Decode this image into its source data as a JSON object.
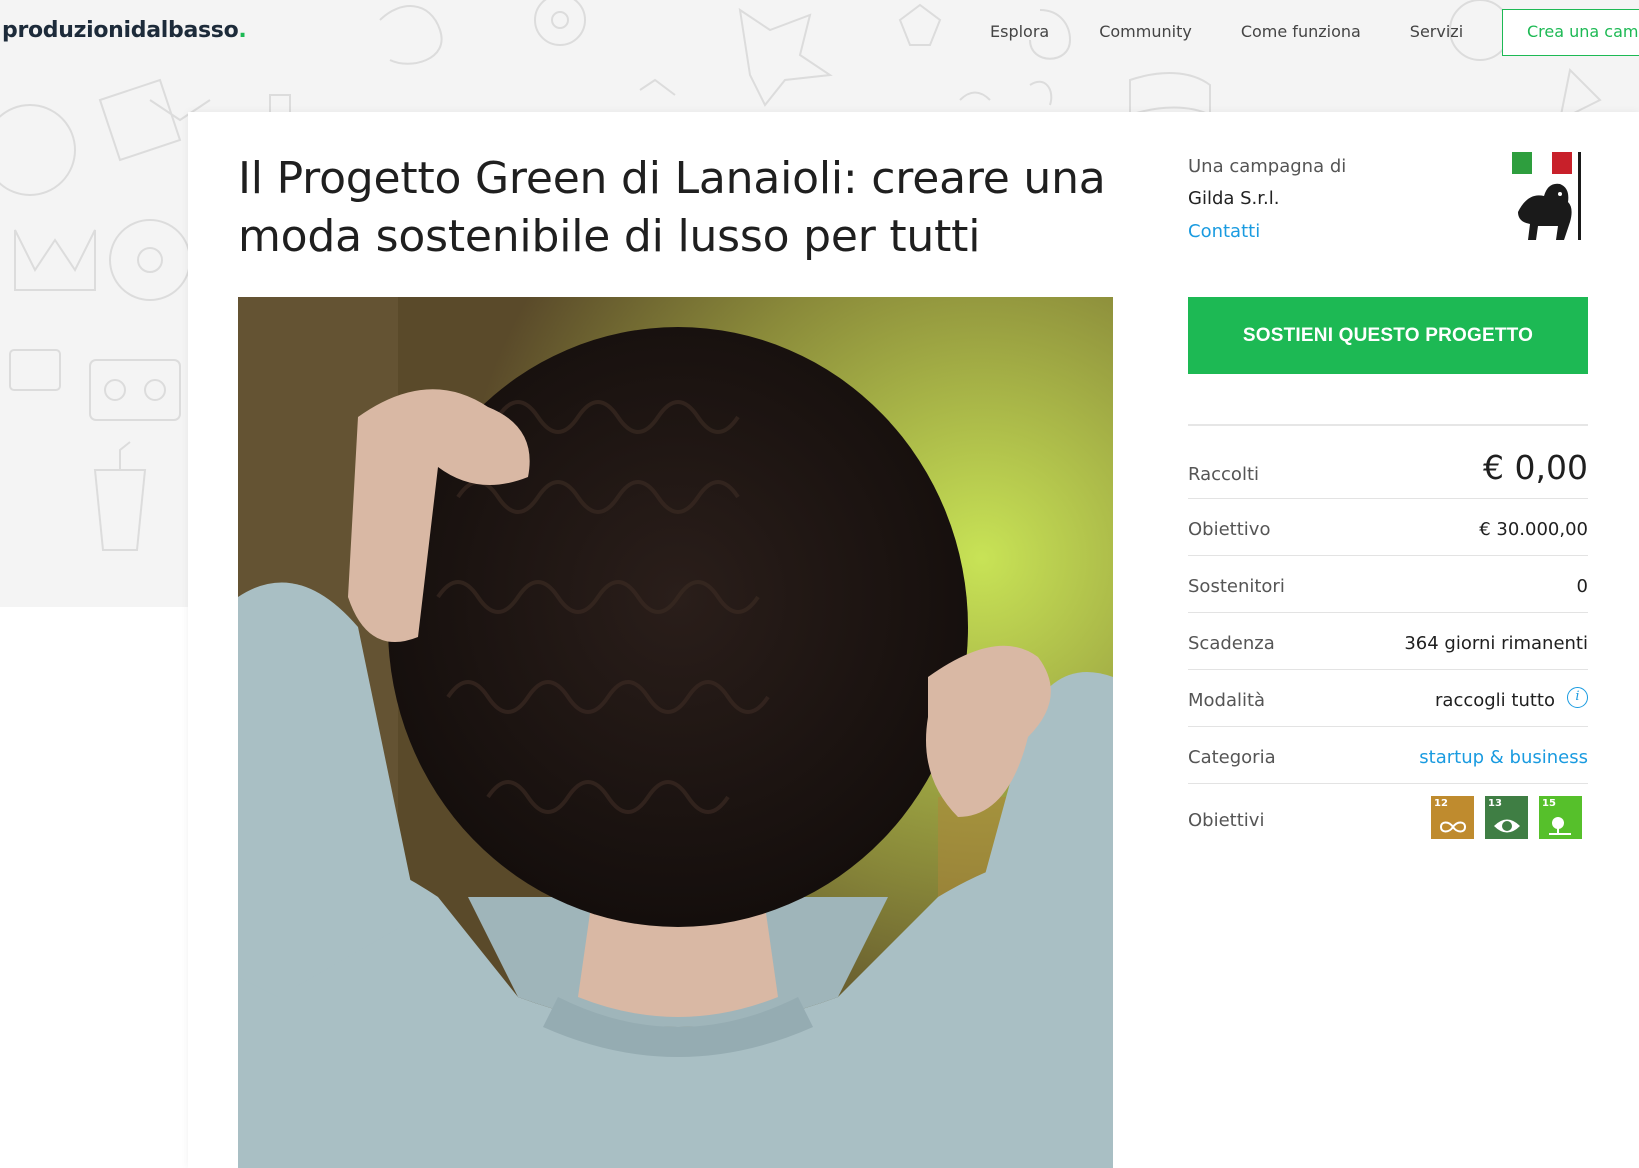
{
  "header": {
    "logo_text": "produzionidalbasso",
    "logo_dot": ".",
    "nav": [
      "Esplora",
      "Community",
      "Come funziona",
      "Servizi"
    ],
    "cta_label": "Crea una campagna"
  },
  "campaign": {
    "title": "Il Progetto Green di Lanaioli: creare una moda sostenibile di lusso per tutti",
    "by_label": "Una campagna di",
    "by_name": "Gilda S.r.l.",
    "contact_label": "Contatti",
    "support_label": "SOSTIENI QUESTO PROGETTO"
  },
  "stats": {
    "raised": {
      "label": "Raccolti",
      "value": "€ 0,00"
    },
    "goal": {
      "label": "Obiettivo",
      "value": "€ 30.000,00"
    },
    "backers": {
      "label": "Sostenitori",
      "value": "0"
    },
    "deadline": {
      "label": "Scadenza",
      "value": "364 giorni rimanenti"
    },
    "mode": {
      "label": "Modalità",
      "value": "raccogli tutto"
    },
    "category": {
      "label": "Categoria",
      "value": "startup & business"
    },
    "goals": {
      "label": "Obiettivi",
      "items": [
        {
          "number": "12",
          "color": "#bf8b2e",
          "icon": "infinity-icon"
        },
        {
          "number": "13",
          "color": "#3f7e44",
          "icon": "eye-earth-icon"
        },
        {
          "number": "15",
          "color": "#56c02b",
          "icon": "tree-icon"
        }
      ]
    }
  },
  "colors": {
    "accent_green": "#1db954",
    "link_blue": "#1a9be0",
    "flag_green": "#2e9e3e",
    "flag_red": "#c8202a"
  }
}
